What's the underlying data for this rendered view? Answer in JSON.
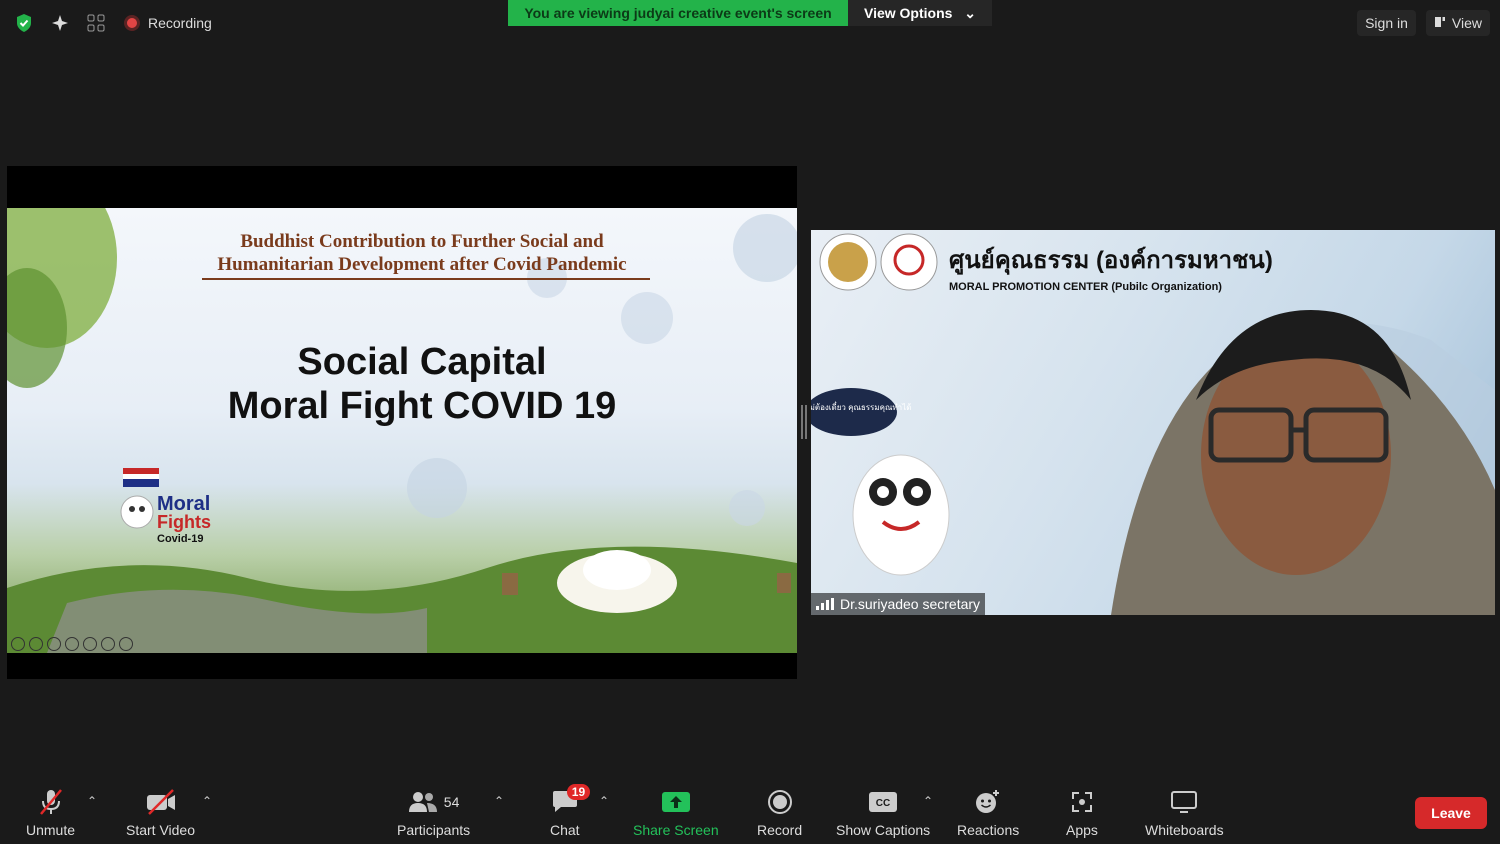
{
  "topbar": {
    "recording_label": "Recording",
    "viewing_banner": "You are viewing judyai creative event's screen",
    "view_options": "View Options",
    "sign_in": "Sign in",
    "view": "View"
  },
  "slide": {
    "title_line1": "Buddhist Contribution to Further Social and",
    "title_line2": "Humanitarian Development after Covid Pandemic",
    "main_line1": "Social Capital",
    "main_line2": "Moral Fight  COVID 19",
    "logo_text1": "Moral",
    "logo_text2": "Fights",
    "logo_text3": "Covid-19"
  },
  "video": {
    "org_thai": "ศูนย์คุณธรรม (องค์การมหาชน)",
    "org_english": "MORAL PROMOTION CENTER  (Pubilc Organization)",
    "mascot_bubble": "ทำดีไม่ต้องเดี๋ยว คุณธรรมคุณทำได้",
    "participant_name": "Dr.suriyadeo secretary"
  },
  "toolbar": {
    "unmute": "Unmute",
    "start_video": "Start Video",
    "participants": "Participants",
    "participants_count": "54",
    "chat": "Chat",
    "chat_badge": "19",
    "share_screen": "Share Screen",
    "record": "Record",
    "show_captions": "Show Captions",
    "reactions": "Reactions",
    "apps": "Apps",
    "whiteboards": "Whiteboards",
    "leave": "Leave"
  },
  "colors": {
    "banner_green": "#23b34a",
    "share_green": "#23c15a",
    "leave_red": "#d6292a",
    "background": "#1a1a1a"
  }
}
